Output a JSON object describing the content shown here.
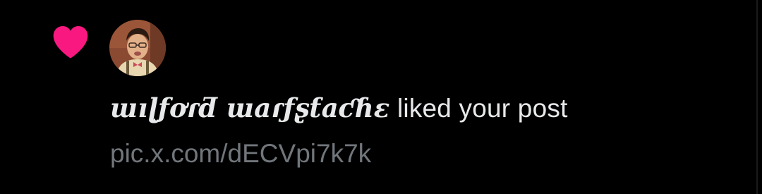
{
  "notification": {
    "type_icon": "heart-icon",
    "type_icon_color": "#f91880",
    "avatar_icon": "user-avatar",
    "username": "ɯıɭƒơɾƌ ɯaɾƒʂƭaƈɦɛ",
    "action_text": " liked your post",
    "link_text": "pic.x.com/dECVpi7k7k"
  },
  "colors": {
    "background": "#000000",
    "primary_text": "#e7e9ea",
    "secondary_text": "#71767b",
    "like_pink": "#f91880"
  }
}
